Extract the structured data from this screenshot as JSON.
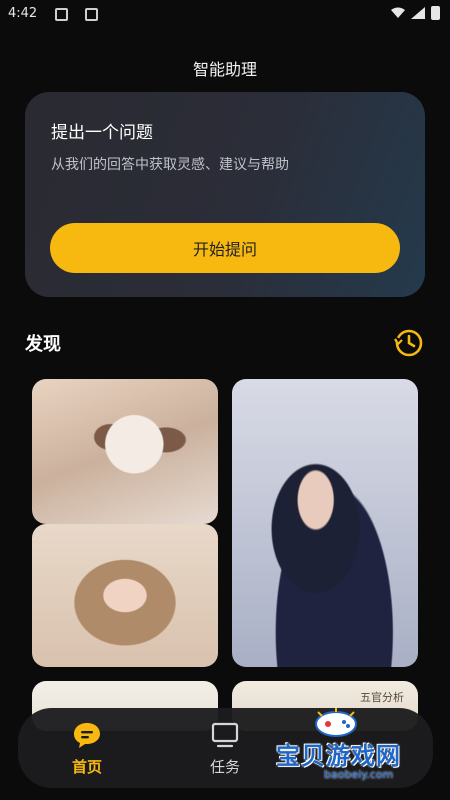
{
  "status": {
    "time": "4:42"
  },
  "header": {
    "title": "智能助理"
  },
  "ask_card": {
    "title": "提出一个问题",
    "subtitle": "从我们的回答中获取灵感、建议与帮助",
    "button_label": "开始提问"
  },
  "discover": {
    "title": "发现",
    "history_icon": "history-clock-icon"
  },
  "cards": [
    {
      "name": "cat-photo"
    },
    {
      "name": "girl-photo-blonde"
    },
    {
      "name": "girl-photo-anime-wall"
    },
    {
      "name": "note-card"
    },
    {
      "name": "five-senses-card",
      "text": "五官分析"
    }
  ],
  "tabbar": {
    "items": [
      {
        "label": "首页",
        "icon": "chat-bubble-icon",
        "active": true
      },
      {
        "label": "任务",
        "icon": "monitor-icon",
        "active": false
      }
    ]
  },
  "watermark": {
    "text": "宝贝游戏网",
    "url": "baobeiy.com"
  },
  "colors": {
    "accent": "#f7b90f",
    "background": "#0b0b0c",
    "card": "#2b2d38"
  }
}
